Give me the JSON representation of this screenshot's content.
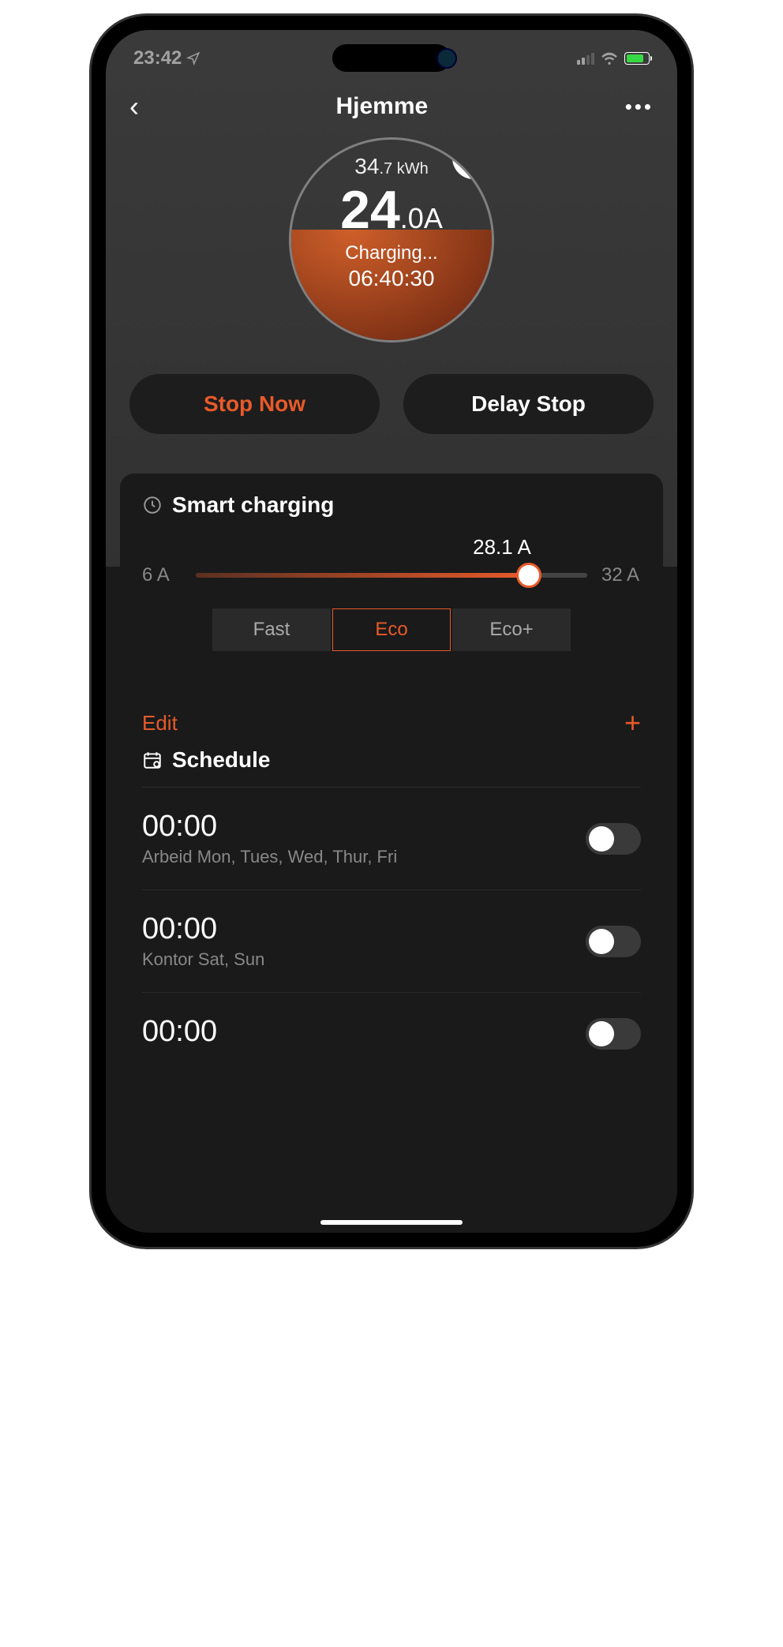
{
  "status": {
    "time": "23:42"
  },
  "header": {
    "title": "Hjemme"
  },
  "gauge": {
    "kwh_big": "34",
    "kwh_small": ".7 kWh",
    "amps_big": "24",
    "amps_small": ".0A",
    "status_text": "Charging...",
    "timer": "06:40:30"
  },
  "actions": {
    "stop_now": "Stop Now",
    "delay_stop": "Delay Stop"
  },
  "smart": {
    "title": "Smart charging",
    "current_value": "28.1 A",
    "min_label": "6 A",
    "max_label": "32 A",
    "modes": {
      "fast": "Fast",
      "eco": "Eco",
      "eco_plus": "Eco+"
    }
  },
  "schedule": {
    "edit": "Edit",
    "title": "Schedule",
    "items": [
      {
        "time": "00:00",
        "days": "Arbeid Mon, Tues, Wed, Thur, Fri",
        "enabled": false
      },
      {
        "time": "00:00",
        "days": "Kontor Sat, Sun",
        "enabled": false
      },
      {
        "time": "00:00",
        "days": "",
        "enabled": false
      }
    ]
  }
}
